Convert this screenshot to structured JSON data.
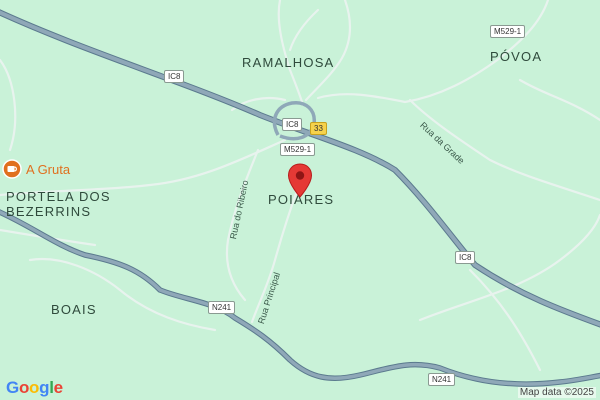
{
  "map": {
    "background_color": "#c9f2d8",
    "places": {
      "ramalhosa": "RAMALHOSA",
      "povoa": "PÓVOA",
      "poiares": "POIARES",
      "portela_line1": "PORTELA DOS",
      "portela_line2": "BEZERRINS",
      "boais": "BOAIS"
    },
    "roads": {
      "rua_da_grade": "Rua da Grade",
      "rua_do_ribeiro": "Rua do Ribeiro",
      "rua_principal": "Rua Principal"
    },
    "shields": {
      "ic8_top": "IC8",
      "ic8_mid": "IC8",
      "ic8_right": "IC8",
      "m529_top": "M529-1",
      "m529_mid": "M529-1",
      "r33": "33",
      "n241_left": "N241",
      "n241_bottom": "N241"
    },
    "poi": {
      "label": "A Gruta",
      "icon": "cafe-icon",
      "color": "#e0701f"
    },
    "marker": {
      "icon": "map-pin-icon",
      "color": "#e53935"
    },
    "colors": {
      "highway": "#7f9aab",
      "minor_road": "#e8f3ee"
    }
  },
  "footer": {
    "logo_letters": [
      "G",
      "o",
      "o",
      "g",
      "l",
      "e"
    ],
    "logo_colors": [
      "#4285f4",
      "#ea4335",
      "#fbbc05",
      "#4285f4",
      "#34a853",
      "#ea4335"
    ],
    "attribution": "Map data ©2025"
  }
}
